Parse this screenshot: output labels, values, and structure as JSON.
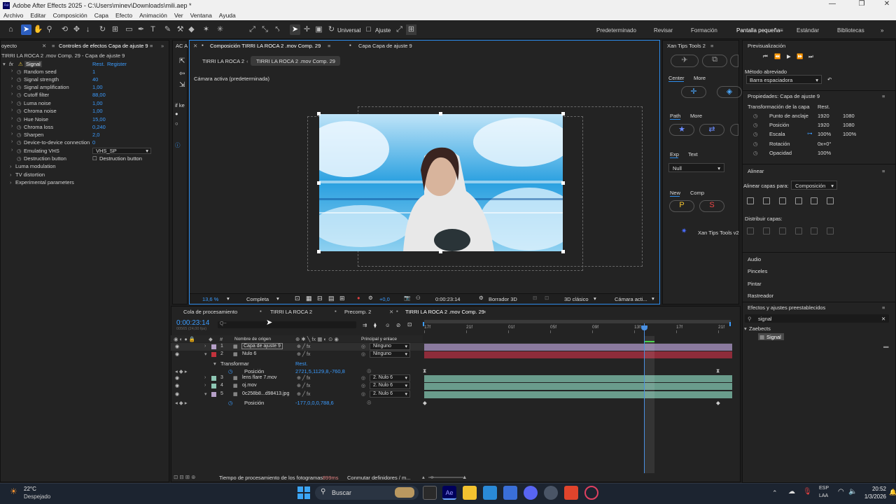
{
  "window": {
    "title": "Adobe After Effects 2025 - C:\\Users\\minev\\Downloads\\mili.aep *"
  },
  "menu": [
    "Archivo",
    "Editar",
    "Composición",
    "Capa",
    "Efecto",
    "Animación",
    "Ver",
    "Ventana",
    "Ayuda"
  ],
  "toolbar": {
    "universal_label": "Universal",
    "ajuste_label": "Ajuste"
  },
  "workspaces": [
    "Predeterminado",
    "Revisar",
    "Formación",
    "Pantalla pequeña",
    "Estándar",
    "Bibliotecas"
  ],
  "effects_panel": {
    "proj_tab": "oyecto",
    "tab": "Controles de efectos Capa de ajuste 9",
    "header": "TIRRI LA ROCA 2 .mov Comp. 29 - Capa de ajuste 9",
    "effect_name": "Signal",
    "rest": "Rest.",
    "register": "Register",
    "params": [
      {
        "name": "Random seed",
        "value": "1"
      },
      {
        "name": "Signal strength",
        "value": "40"
      },
      {
        "name": "Signal amplification",
        "value": "1,00"
      },
      {
        "name": "Cutoff filter",
        "value": "88,00"
      },
      {
        "name": "Luma noise",
        "value": "1,00"
      },
      {
        "name": "Chroma noise",
        "value": "1,00"
      },
      {
        "name": "Hue Noise",
        "value": "15,00"
      },
      {
        "name": "Chroma loss",
        "value": "0,240"
      },
      {
        "name": "Sharpen",
        "value": "2,0"
      },
      {
        "name": "Device-to-device connection",
        "value": "0"
      },
      {
        "name": "Emulating VHS",
        "value": "VHS_SP"
      },
      {
        "name": "Destruction button",
        "value": "Destruction button"
      }
    ],
    "groups": [
      "Luma modulation",
      "TV distortion",
      "Experimental parameters"
    ]
  },
  "composition": {
    "tab_comp": "Composición TIRRI LA ROCA 2 .mov Comp. 29",
    "tab_layer": "Capa Capa de ajuste 9",
    "breadcrumb1": "TIRRI LA ROCA 2",
    "breadcrumb2": "TIRRI LA ROCA 2 .mov Comp. 29",
    "camera_label": "Cámara activa (predeterminada)",
    "side_label": "if ke",
    "zoom": "13,6 %",
    "resolution": "Completa",
    "exposure": "+0,0",
    "time": "0:00:23:14",
    "draft": "Borrador 3D",
    "renderer": "3D clásico",
    "camera": "Cámara acti..."
  },
  "timeline": {
    "tabs": [
      "Cola de procesamiento",
      "TIRRI LA ROCA 2",
      "Precomp. 2",
      "TIRRI LA ROCA 2 .mov Comp. 29"
    ],
    "current_time": "0:00:23:14",
    "fps": "00565 (24,00 fps)",
    "search_icon_label": "Q~",
    "col_source": "Nombre de origen",
    "col_parent": "Principal y enlace",
    "ruler": [
      "17f",
      "21f",
      "01f",
      "05f",
      "09f",
      "13f",
      "17f",
      "21f"
    ],
    "layers": [
      {
        "num": "1",
        "name": "Capa de ajuste 9",
        "parent": "Ninguno",
        "color": "#b6a0c8"
      },
      {
        "num": "2",
        "name": "Nulo 6",
        "parent": "Ninguno",
        "color": "#c2323c"
      },
      {
        "num": "3",
        "name": "lens flare 7.mov",
        "parent": "2. Nulo 6",
        "color": "#8ec7b4"
      },
      {
        "num": "4",
        "name": "oj.mov",
        "parent": "2. Nulo 6",
        "color": "#8ec7b4"
      },
      {
        "num": "5",
        "name": "0c258b8...d98413.jpg",
        "parent": "2. Nulo 6",
        "color": "#b6a0c8"
      }
    ],
    "transform_label": "Transformar",
    "transform_rest": "Rest.",
    "position_label": "Posición",
    "position_value_1": "2721,5,1129,8,-760,8",
    "position_value_2": "-177,0,0,0,788,6",
    "status_label": "Tiempo de procesamiento de los fotogramas:",
    "status_value": "899ms",
    "status_toggle": "Conmutar definidores / m..."
  },
  "tools_panel": {
    "title": "Xan Tips Tools 2",
    "center": "Center",
    "more": "More",
    "path": "Path",
    "more2": "More",
    "exp": "Exp",
    "text": "Text",
    "null_option": "Null",
    "new": "New",
    "comp": "Comp",
    "p": "P",
    "s": "S",
    "footer": "Xan Tips Tools v2"
  },
  "preview": {
    "title": "Previsualización",
    "shortcut_label": "Método abreviado",
    "shortcut_value": "Barra espaciadora"
  },
  "properties": {
    "title": "Propiedades: Capa de ajuste 9",
    "section": "Transformación de la capa",
    "rest": "Rest.",
    "rows": [
      {
        "name": "Punto de anclaje",
        "v1": "1920",
        "v2": "1080"
      },
      {
        "name": "Posición",
        "v1": "1920",
        "v2": "1080"
      },
      {
        "name": "Escala",
        "v1": "100%",
        "v2": "100%"
      },
      {
        "name": "Rotación",
        "v1": "0x+0°",
        "v2": ""
      },
      {
        "name": "Opacidad",
        "v1": "100%",
        "v2": ""
      }
    ]
  },
  "align": {
    "title": "Alinear",
    "align_to": "Alinear capas para:",
    "align_value": "Composición",
    "distribute": "Distribuir capas:"
  },
  "collapsed_panels": [
    "Audio",
    "Pinceles",
    "Pintar",
    "Rastreador"
  ],
  "effects_presets": {
    "title": "Efectos y ajustes preestablecidos",
    "search": "signal",
    "folder": "Zaebects",
    "item": "Signal"
  },
  "taskbar": {
    "temp": "22°C",
    "weather": "Despejado",
    "search": "Buscar",
    "lang1": "ESP",
    "lang2": "LAA",
    "time": "20:52",
    "date": "1/3/2026"
  },
  "colors": {
    "accent": "#2d8ceb",
    "value_blue": "#3b9cff",
    "playhead": "#4a90e2"
  }
}
